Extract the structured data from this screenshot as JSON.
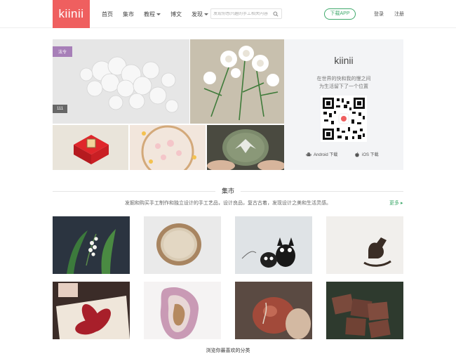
{
  "header": {
    "logo": "kiinii",
    "nav": [
      {
        "label": "首页",
        "dropdown": false
      },
      {
        "label": "集市",
        "dropdown": false
      },
      {
        "label": "教程",
        "dropdown": true
      },
      {
        "label": "博文",
        "dropdown": false
      },
      {
        "label": "发现",
        "dropdown": true
      }
    ],
    "search_placeholder": "发现你感兴趣的手工相关内容",
    "download_label": "下载APP",
    "login_label": "登录",
    "register_label": "注册"
  },
  "hero": {
    "tag": "法令",
    "count": "111",
    "promo": {
      "title": "kiinii",
      "line1": "在世界的快和我的慢之间",
      "line2": "为生活留下了一个位置",
      "android": "Android 下载",
      "ios": "iOS 下载"
    }
  },
  "market": {
    "title": "集市",
    "description": "发掘和购买手工制作和独立设计的手工艺品，设计良品，复古古着，发现设计之美和生活灵感。",
    "more": "更多"
  },
  "bottom_text": "浏览你最喜欢的分类",
  "colors": {
    "brand": "#ef5f5f",
    "accent": "#3fa96b",
    "tag": "#a77fb8"
  }
}
